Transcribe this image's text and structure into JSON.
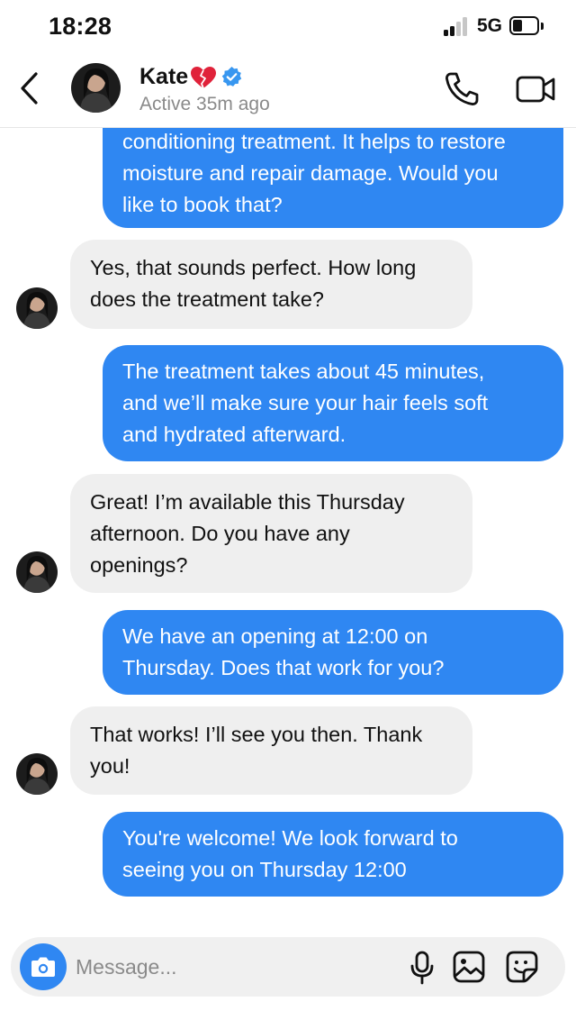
{
  "status_bar": {
    "time": "18:28",
    "network": "5G",
    "signal_bars_filled": 2,
    "signal_bars_total": 4,
    "battery_icon": "battery-icon"
  },
  "header": {
    "back_icon": "chevron-left-icon",
    "contact_name": "Kate",
    "name_emoji": "broken-heart-icon",
    "verified_icon": "verified-badge-icon",
    "activity_status": "Active 35m ago",
    "call_icon": "phone-icon",
    "video_icon": "video-camera-icon"
  },
  "messages": [
    {
      "direction": "outgoing",
      "lines": [
        "conditioning treatment. It helps to restore",
        "moisture and repair damage. Would you",
        "like to book that?"
      ]
    },
    {
      "direction": "incoming",
      "lines": [
        "Yes, that sounds perfect. How long",
        "does the treatment take?"
      ]
    },
    {
      "direction": "outgoing",
      "lines": [
        "The treatment takes about 45 minutes,",
        "and we’ll make sure your hair feels soft",
        "and hydrated afterward."
      ]
    },
    {
      "direction": "incoming",
      "lines": [
        "Great! I’m available this Thursday",
        "afternoon. Do you have any",
        "openings?"
      ]
    },
    {
      "direction": "outgoing",
      "lines": [
        "We have an opening at 12:00 on",
        "Thursday. Does that work for you?"
      ]
    },
    {
      "direction": "incoming",
      "lines": [
        "That works! I’ll see you then. Thank",
        "you!"
      ]
    },
    {
      "direction": "outgoing",
      "lines": [
        "You're welcome! We look forward to",
        "seeing you on Thursday 12:00"
      ]
    }
  ],
  "composer": {
    "camera_icon": "camera-icon",
    "placeholder": "Message...",
    "value": "",
    "mic_icon": "microphone-icon",
    "gallery_icon": "image-icon",
    "sticker_icon": "sticker-icon"
  },
  "colors": {
    "outgoing_bubble": "#2f87f2",
    "incoming_bubble": "#efefef",
    "verified": "#3897f0",
    "heart": "#e0223a"
  }
}
